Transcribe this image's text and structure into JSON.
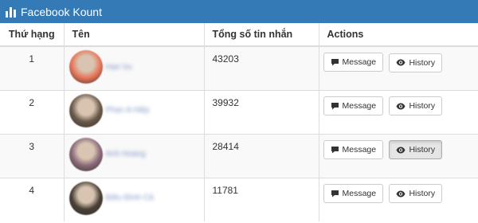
{
  "app": {
    "title": "Facebook Kount"
  },
  "table": {
    "headers": {
      "rank": "Thứ hạng",
      "name": "Tên",
      "total": "Tổng số tin nhắn",
      "actions": "Actions"
    },
    "message_label": "Message",
    "history_label": "History",
    "rows": [
      {
        "rank": "1",
        "name": "Hari Vu",
        "total": "43203",
        "avatar_color": "#e8765a"
      },
      {
        "rank": "2",
        "name": "Phan A Hiệp",
        "total": "39932",
        "avatar_color": "#6b5a4a"
      },
      {
        "rank": "3",
        "name": "Anh Hoang",
        "total": "28414",
        "avatar_color": "#8a6a7a"
      },
      {
        "rank": "4",
        "name": "Điều Đình Cả",
        "total": "11781",
        "avatar_color": "#4a4038"
      }
    ]
  },
  "colors": {
    "topbar": "#337ab7",
    "name_link": "#7f93c6"
  }
}
